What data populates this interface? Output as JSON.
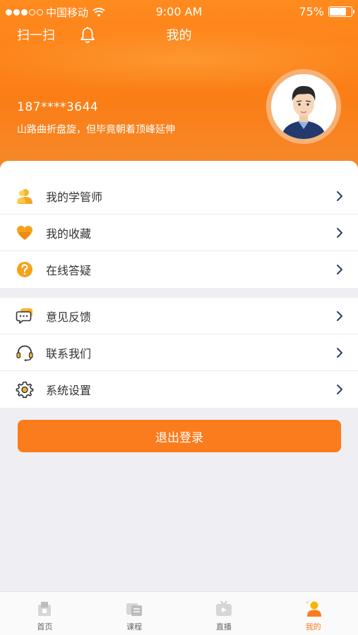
{
  "status_bar": {
    "carrier": "中国移动",
    "time": "9:00 AM",
    "battery": "75%",
    "battery_level": 0.75
  },
  "header": {
    "scan_label": "扫一扫",
    "title": "我的",
    "phone": "187****3644",
    "motto": "山路曲折盘旋，但毕竟朝着顶峰延伸"
  },
  "menu_group_1": [
    {
      "label": "我的学管师",
      "icon": "person-icon"
    },
    {
      "label": "我的收藏",
      "icon": "heart-icon"
    },
    {
      "label": "在线答疑",
      "icon": "question-icon"
    }
  ],
  "menu_group_2": [
    {
      "label": "意见反馈",
      "icon": "feedback-icon"
    },
    {
      "label": "联系我们",
      "icon": "headset-icon"
    },
    {
      "label": "系统设置",
      "icon": "gear-icon"
    }
  ],
  "logout_label": "退出登录",
  "tabs": [
    {
      "label": "首页",
      "icon": "home-icon",
      "active": false
    },
    {
      "label": "课程",
      "icon": "course-icon",
      "active": false
    },
    {
      "label": "直播",
      "icon": "live-icon",
      "active": false
    },
    {
      "label": "我的",
      "icon": "profile-icon",
      "active": true
    }
  ],
  "colors": {
    "accent": "#fb7c1d",
    "arrow": "#2c3e70",
    "background": "#eeeef3"
  }
}
